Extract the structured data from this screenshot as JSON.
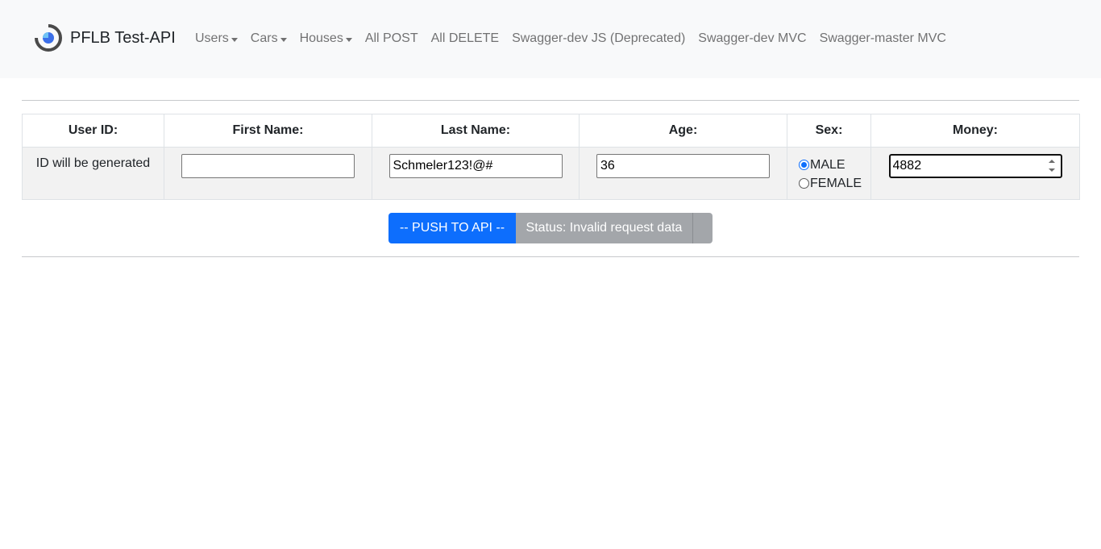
{
  "navbar": {
    "brand": "PFLB Test-API",
    "logo_icon": "pflb-logo-icon",
    "items": [
      {
        "label": "Users",
        "dropdown": true
      },
      {
        "label": "Cars",
        "dropdown": true
      },
      {
        "label": "Houses",
        "dropdown": true
      },
      {
        "label": "All POST",
        "dropdown": false
      },
      {
        "label": "All DELETE",
        "dropdown": false
      },
      {
        "label": "Swagger-dev JS (Deprecated)",
        "dropdown": false
      },
      {
        "label": "Swagger-dev MVC",
        "dropdown": false
      },
      {
        "label": "Swagger-master MVC",
        "dropdown": false
      }
    ]
  },
  "form": {
    "headers": {
      "user_id": "User ID:",
      "first_name": "First Name:",
      "last_name": "Last Name:",
      "age": "Age:",
      "sex": "Sex:",
      "money": "Money:"
    },
    "user_id_text": "ID will be generated",
    "first_name_value": "",
    "last_name_value": "Schmeler123!@#",
    "age_value": "36",
    "money_value": "4882",
    "sex_options": [
      {
        "label": "MALE",
        "checked": true
      },
      {
        "label": "FEMALE",
        "checked": false
      }
    ],
    "push_button": "-- PUSH TO API --",
    "status": "Status: Invalid request data"
  },
  "colors": {
    "primary": "#0d6efd",
    "status_bg": "#a3a6aa",
    "navbar_bg": "#f8f9fa",
    "row_bg": "#f2f2f2"
  }
}
